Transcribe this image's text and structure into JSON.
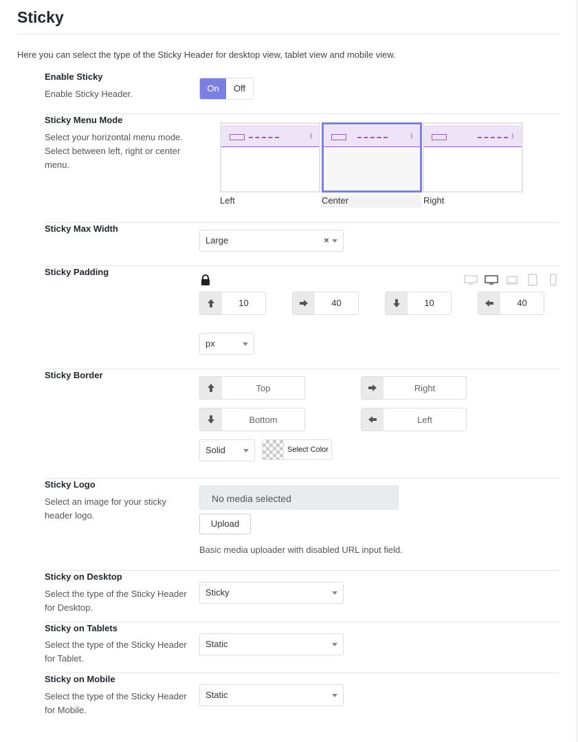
{
  "page": {
    "title": "Sticky",
    "intro": "Here you can select the type of the Sticky Header for desktop view, tablet view and mobile view."
  },
  "enable_sticky": {
    "label": "Enable Sticky",
    "description": "Enable Sticky Header.",
    "on_label": "On",
    "off_label": "Off",
    "selected": "On"
  },
  "menu_mode": {
    "label": "Sticky Menu Mode",
    "description": "Select your horizontal menu mode. Select between left, right or center menu.",
    "options": [
      {
        "label": "Left",
        "num": "1"
      },
      {
        "label": "Center",
        "num": "1"
      },
      {
        "label": "Right",
        "num": "1"
      }
    ],
    "selected": "Center"
  },
  "max_width": {
    "label": "Sticky Max Width",
    "value": "Large",
    "clear_symbol": "×"
  },
  "padding": {
    "label": "Sticky Padding",
    "top": "10",
    "right": "40",
    "bottom": "10",
    "left": "40",
    "unit": "px"
  },
  "border": {
    "label": "Sticky Border",
    "top_placeholder": "Top",
    "right_placeholder": "Right",
    "bottom_placeholder": "Bottom",
    "left_placeholder": "Left",
    "style": "Solid",
    "color_label": "Select Color"
  },
  "logo": {
    "label": "Sticky Logo",
    "description": "Select an image for your sticky header logo.",
    "media_text": "No media selected",
    "upload_label": "Upload",
    "hint": "Basic media uploader with disabled URL input field."
  },
  "desktop": {
    "label": "Sticky on Desktop",
    "description": "Select the type of the Sticky Header for Desktop.",
    "value": "Sticky"
  },
  "tablets": {
    "label": "Sticky on Tablets",
    "description": "Select the type of the Sticky Header for Tablet.",
    "value": "Static"
  },
  "mobile": {
    "label": "Sticky on Mobile",
    "description": "Select the type of the Sticky Header for Mobile.",
    "value": "Static"
  },
  "colors": {
    "accent": "#7a7fe0",
    "menu_preview": "#9b59c4",
    "menu_band": "#efe4f7"
  }
}
